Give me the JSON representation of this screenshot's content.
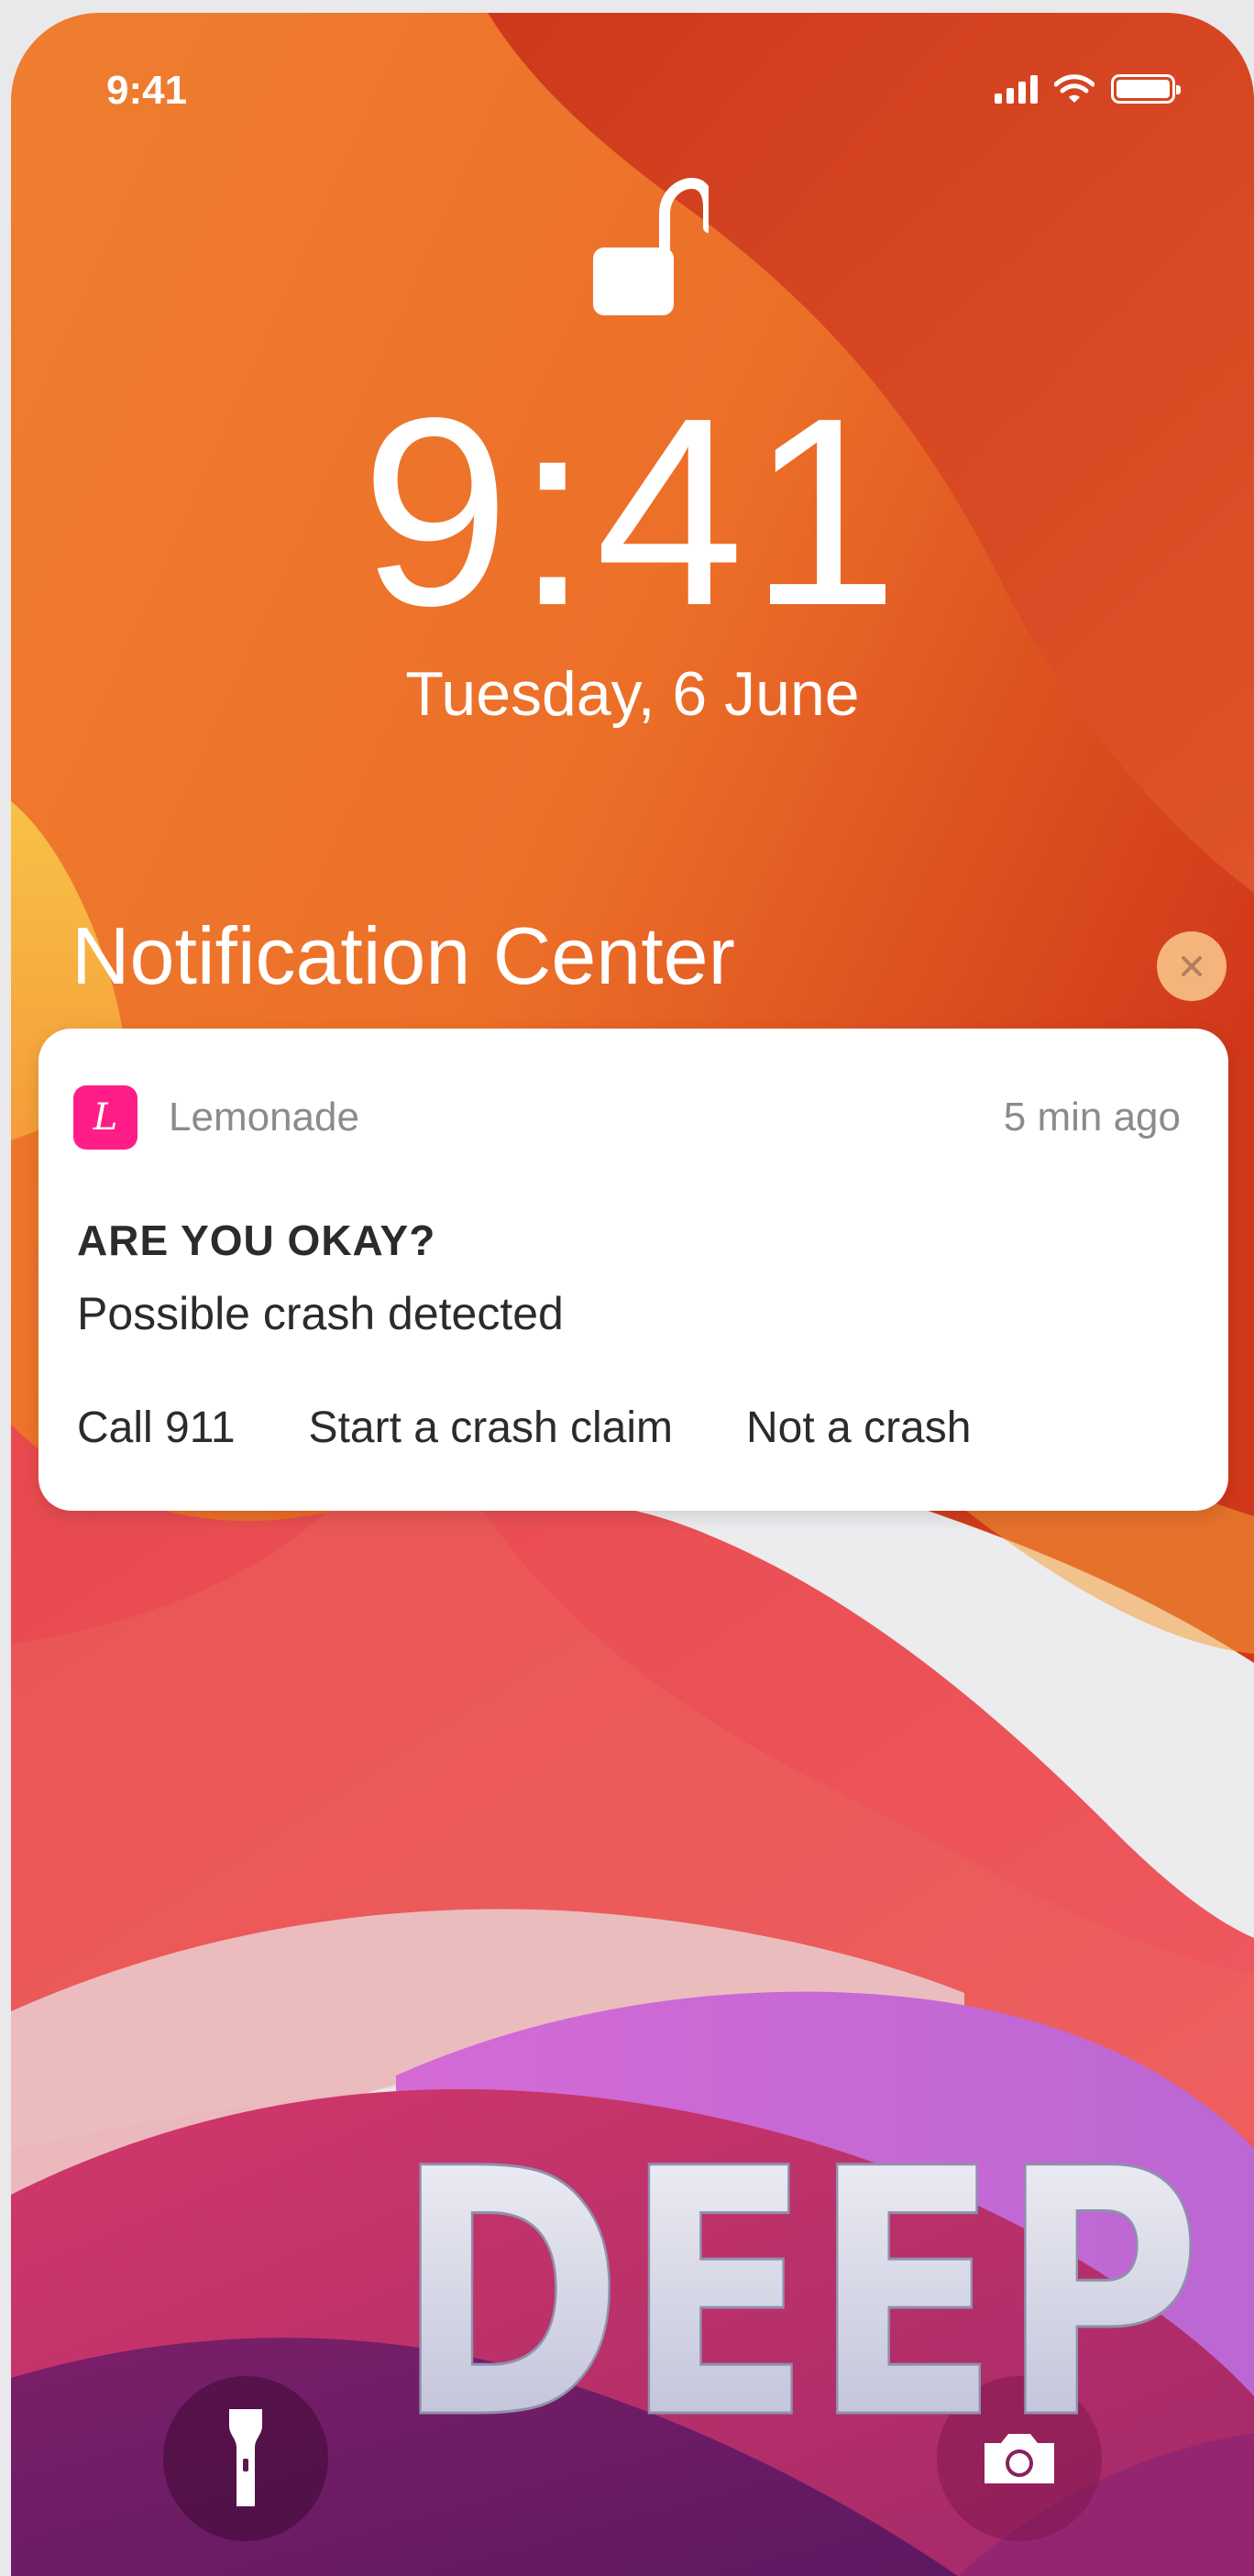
{
  "status_bar": {
    "time": "9:41"
  },
  "lock_screen": {
    "time": "9:41",
    "date": "Tuesday, 6 June"
  },
  "notification_center": {
    "title": "Notification Center"
  },
  "notification": {
    "app_name": "Lemonade",
    "app_icon_glyph": "L",
    "timestamp": "5 min ago",
    "title": "ARE YOU OKAY?",
    "body": "Possible crash detected",
    "actions": [
      "Call 911",
      "Start a crash claim",
      "Not a crash"
    ]
  },
  "watermark": {
    "text": "DEEP"
  },
  "icons": {
    "lock": "unlocked-padlock-icon",
    "signal": "cellular-signal-icon",
    "wifi": "wifi-icon",
    "battery": "battery-icon",
    "close": "close-icon",
    "flashlight": "flashlight-icon",
    "camera": "camera-icon"
  },
  "colors": {
    "app_brand": "#ff1e87",
    "wallpaper_orange": "#e9762e",
    "wallpaper_red": "#cf3b1a",
    "wallpaper_pink": "#e8455e",
    "wallpaper_purple": "#b45cc9"
  }
}
